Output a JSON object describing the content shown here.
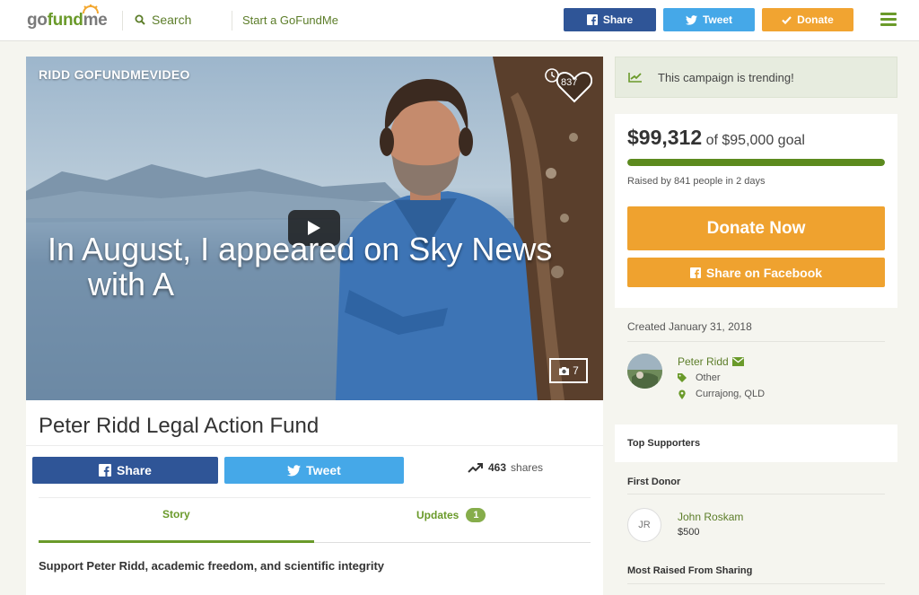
{
  "header": {
    "logo": {
      "go": "go",
      "fund": "fund",
      "me": "me"
    },
    "search_label": "Search",
    "start_label": "Start a GoFundMe",
    "share_label": "Share",
    "tweet_label": "Tweet",
    "donate_label": "Donate"
  },
  "video": {
    "title": "RIDD GOFUNDMEVIDEO",
    "heart_count": "837",
    "caption_line1": "In August, I appeared on Sky News",
    "caption_line2": "with A",
    "photo_count": "7"
  },
  "campaign": {
    "title": "Peter Ridd Legal Action Fund",
    "share_label": "Share",
    "tweet_label": "Tweet",
    "shares_count": "463",
    "shares_label": "shares",
    "tabs": {
      "story": "Story",
      "updates": "Updates",
      "updates_badge": "1"
    },
    "story_heading": "Support Peter Ridd, academic freedom, and scientific integrity"
  },
  "sidebar": {
    "trending": "This campaign is trending!",
    "raised_amount": "$99,312",
    "goal_text": "of $95,000 goal",
    "progress": 1.0,
    "raised_by": "Raised by 841 people in 2 days",
    "donate_now": "Donate Now",
    "share_facebook": "Share on Facebook",
    "created": "Created January 31, 2018",
    "organizer": {
      "name": "Peter Ridd",
      "category": "Other",
      "location": "Currajong, QLD"
    },
    "top_supporters": "Top Supporters",
    "first_donor_label": "First Donor",
    "first_donor": {
      "initials": "JR",
      "name": "John Roskam",
      "amount": "$500"
    },
    "most_raised_label": "Most Raised From Sharing"
  },
  "colors": {
    "brand_green": "#6a9a2a",
    "facebook": "#2f5597",
    "twitter": "#45a8e8",
    "donate_orange": "#efa22f"
  }
}
